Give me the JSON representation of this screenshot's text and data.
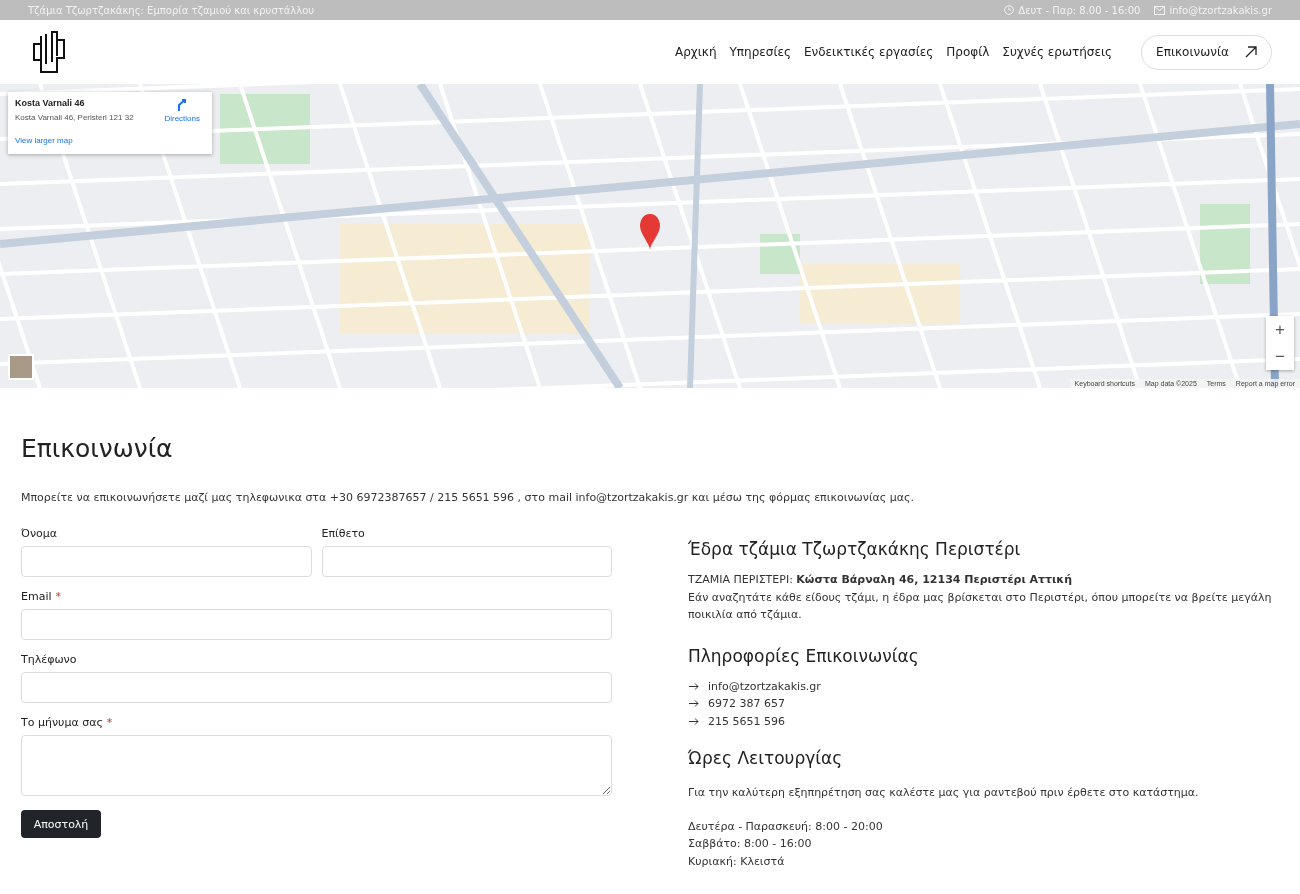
{
  "top_bar": {
    "tagline": "Τζάμια Τζωρτζακάκης: Εμπορία τζαμιού και κρυστάλλου",
    "hours": "Δευτ - Παρ: 8.00 - 16:00",
    "email": "info@tzortzakakis.gr"
  },
  "nav": {
    "links": [
      "Αρχική",
      "Υπηρεσίες",
      "Ενδεικτικές εργασίες",
      "Προφίλ",
      "Συχνές ερωτήσεις"
    ],
    "cta": "Επικοινωνία"
  },
  "map": {
    "place_title": "Kosta Varnali 46",
    "place_address": "Kosta Varnali 46, Peristeri 121 32",
    "directions": "Directions",
    "larger_map": "View larger map",
    "zoom_in": "+",
    "zoom_out": "−",
    "attribution": [
      "Keyboard shortcuts",
      "Map data ©2025",
      "Terms",
      "Report a map error"
    ]
  },
  "contact": {
    "heading": "Επικοινωνία",
    "intro": "Μπορείτε να επικοινωνήσετε μαζί μας τηλεφωνικα στα +30 6972387657 / 215 5651 596 , στο mail info@tzortzakakis.gr και μέσω της φόρμας επικοινωνίας μας.",
    "form": {
      "fields": [
        {
          "label": "Όνομα",
          "required": false,
          "kind": "input",
          "half": true
        },
        {
          "label": "Επίθετο",
          "required": false,
          "kind": "input",
          "half": true
        },
        {
          "label": "Email",
          "required": true,
          "kind": "input",
          "half": false
        },
        {
          "label": "Τηλέφωνο",
          "required": false,
          "kind": "input",
          "half": false
        },
        {
          "label": "Το μήνυμα σας",
          "required": true,
          "kind": "textarea",
          "half": false
        }
      ],
      "required_mark": "*",
      "submit": "Αποστολή"
    },
    "info": {
      "hq_heading": "Έδρα τζάμια Τζωρτζακάκης Περιστέρι",
      "hq_text": "ΤΖΑΜΙΑ ΠΕΡΙΣΤΕΡΙ: **Κώστα Βάρναλη 46, 12134 Περιστέρι Αττική**",
      "hq_desc": "Εάν αναζητάτε κάθε είδους τζάμι, η έδρα μας βρίσκεται στο Περιστέρι, όπου μπορείτε να βρείτε μεγάλη ποικιλία από τζάμια.",
      "info_heading": "Πληροφορίες Επικοινωνίας",
      "info_items": [
        "info@tzortzakakis.gr",
        "6972 387 657",
        "215 5651 596"
      ],
      "hours_heading": "Ώρες Λειτουργίας",
      "hours_note": "Για την καλύτερη εξηπηρέτηση σας καλέστε μας για ραντεβού πριν έρθετε στο κατάστημα.",
      "hours": [
        "Δευτέρα - Παρασκευή: 8:00 - 20:00",
        "Σαββάτο: 8:00 - 16:00",
        "Κυριακή: Κλειστά"
      ]
    }
  }
}
